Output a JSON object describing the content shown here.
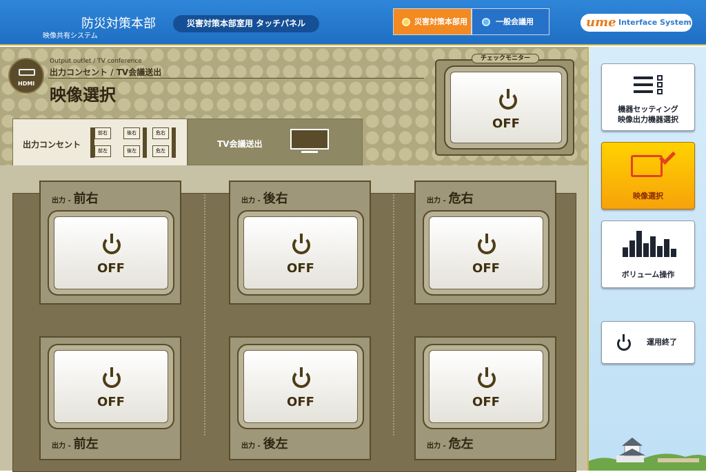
{
  "header": {
    "title": "防災対策本部",
    "subtitle": "映像共有システム",
    "panel_label": "災害対策本部室用 タッチパネル",
    "modes": [
      {
        "label": "災害対策本部用",
        "active": true
      },
      {
        "label": "一般会議用",
        "active": false
      }
    ],
    "logo_text": "Interface System"
  },
  "main": {
    "hdmi_label": "HDMI",
    "title_en": "Output outlet / TV conference",
    "title_jp": "出力コンセント / TV会議送出",
    "heading": "映像選択",
    "tabs": [
      {
        "label": "出力コンセント",
        "active": true
      },
      {
        "label": "TV会議送出",
        "active": false
      }
    ],
    "mini_labels": [
      "前右",
      "後右",
      "危右",
      "前左",
      "後左",
      "危左"
    ],
    "check_monitor": {
      "label": "チェックモニター",
      "state": "OFF"
    },
    "outputs": [
      {
        "prefix": "出力 -",
        "name": "前右",
        "state": "OFF"
      },
      {
        "prefix": "出力 -",
        "name": "後右",
        "state": "OFF"
      },
      {
        "prefix": "出力 -",
        "name": "危右",
        "state": "OFF"
      },
      {
        "prefix": "出力 -",
        "name": "前左",
        "state": "OFF"
      },
      {
        "prefix": "出力 -",
        "name": "後左",
        "state": "OFF"
      },
      {
        "prefix": "出力 -",
        "name": "危左",
        "state": "OFF"
      }
    ]
  },
  "sidebar": {
    "items": [
      {
        "label1": "機器セッティング",
        "label2": "映像出力機器選択",
        "active": false,
        "icon": "checklist-icon"
      },
      {
        "label1": "映像選択",
        "active": true,
        "icon": "monitor-check-icon"
      },
      {
        "label1": "ボリューム操作",
        "active": false,
        "icon": "equalizer-icon"
      },
      {
        "label1": "運用終了",
        "active": false,
        "icon": "power-icon"
      }
    ]
  },
  "colors": {
    "header": "#1f6fc4",
    "accent_orange": "#f28a21",
    "active_side": "#ffd200",
    "panel": "#c7c1a6"
  }
}
